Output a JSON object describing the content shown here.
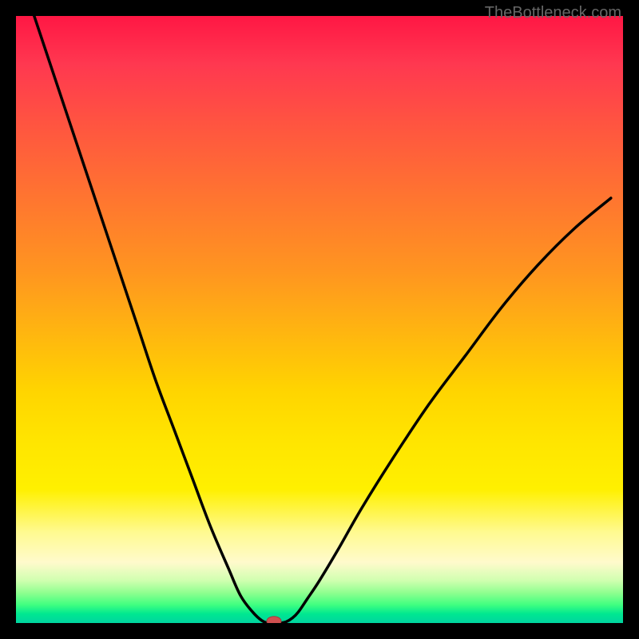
{
  "watermark": "TheBottleneck.com",
  "chart_data": {
    "type": "line",
    "title": "",
    "xlabel": "",
    "ylabel": "",
    "x": [
      0.03,
      0.05,
      0.08,
      0.11,
      0.14,
      0.17,
      0.2,
      0.23,
      0.26,
      0.29,
      0.32,
      0.35,
      0.37,
      0.39,
      0.405,
      0.415,
      0.425,
      0.435,
      0.445,
      0.455,
      0.465,
      0.48,
      0.5,
      0.53,
      0.57,
      0.62,
      0.68,
      0.74,
      0.8,
      0.86,
      0.92,
      0.98
    ],
    "values": [
      1.0,
      0.94,
      0.85,
      0.76,
      0.67,
      0.58,
      0.49,
      0.4,
      0.32,
      0.24,
      0.16,
      0.09,
      0.045,
      0.018,
      0.004,
      0.0,
      0.0,
      0.0,
      0.002,
      0.008,
      0.018,
      0.04,
      0.07,
      0.12,
      0.19,
      0.27,
      0.36,
      0.44,
      0.52,
      0.59,
      0.65,
      0.7
    ],
    "xlim": [
      0,
      1
    ],
    "ylim": [
      0,
      1
    ],
    "marker": {
      "x": 0.425,
      "y": 0.003,
      "color": "#d05050"
    },
    "background": "rainbow-gradient"
  }
}
